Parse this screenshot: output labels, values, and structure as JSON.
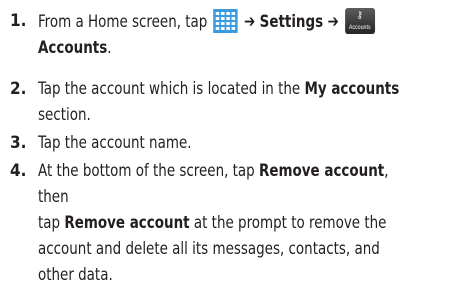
{
  "steps": [
    {
      "number": "1.",
      "parts": {
        "t1": "From a Home screen, tap",
        "arrow1": "➔",
        "settings": "Settings",
        "arrow2": "➔",
        "accounts_icon_label": "Accounts",
        "accounts": "Accounts",
        "end": "."
      }
    },
    {
      "number": "2.",
      "parts": {
        "t1": "Tap the account which is located in the",
        "my_accounts": "My accounts",
        "t2": "section."
      }
    },
    {
      "number": "3.",
      "parts": {
        "t1": "Tap the account name."
      }
    },
    {
      "number": "4.",
      "parts": {
        "t1": "At the bottom of the screen, tap",
        "remove1": "Remove account",
        "t2": ", then",
        "t3": "tap",
        "remove2": "Remove account",
        "t4": "at the prompt to remove the",
        "t5": "account and delete all its messages, contacts, and",
        "t6": "other data."
      }
    }
  ],
  "icons": {
    "apps_icon": "apps-grid-icon",
    "accounts_icon": "accounts-key-icon",
    "apps_icon_color": "#3a9be0"
  }
}
